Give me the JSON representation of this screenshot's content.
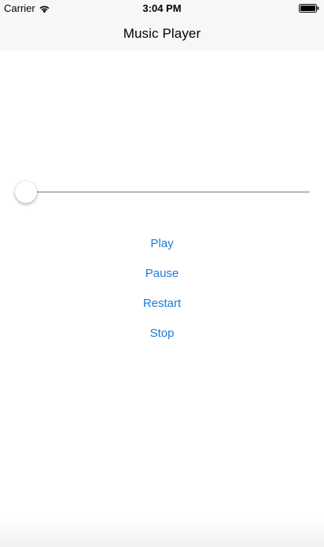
{
  "status_bar": {
    "carrier": "Carrier",
    "time": "3:04 PM",
    "wifi_icon": "wifi-icon",
    "battery_icon": "battery-icon"
  },
  "nav": {
    "title": "Music Player"
  },
  "slider": {
    "progress": 0.0
  },
  "controls": {
    "play_label": "Play",
    "pause_label": "Pause",
    "restart_label": "Restart",
    "stop_label": "Stop"
  },
  "colors": {
    "accent": "#1a7cdc",
    "nav_background": "#f7f7f7",
    "track": "#b7b7b7"
  }
}
